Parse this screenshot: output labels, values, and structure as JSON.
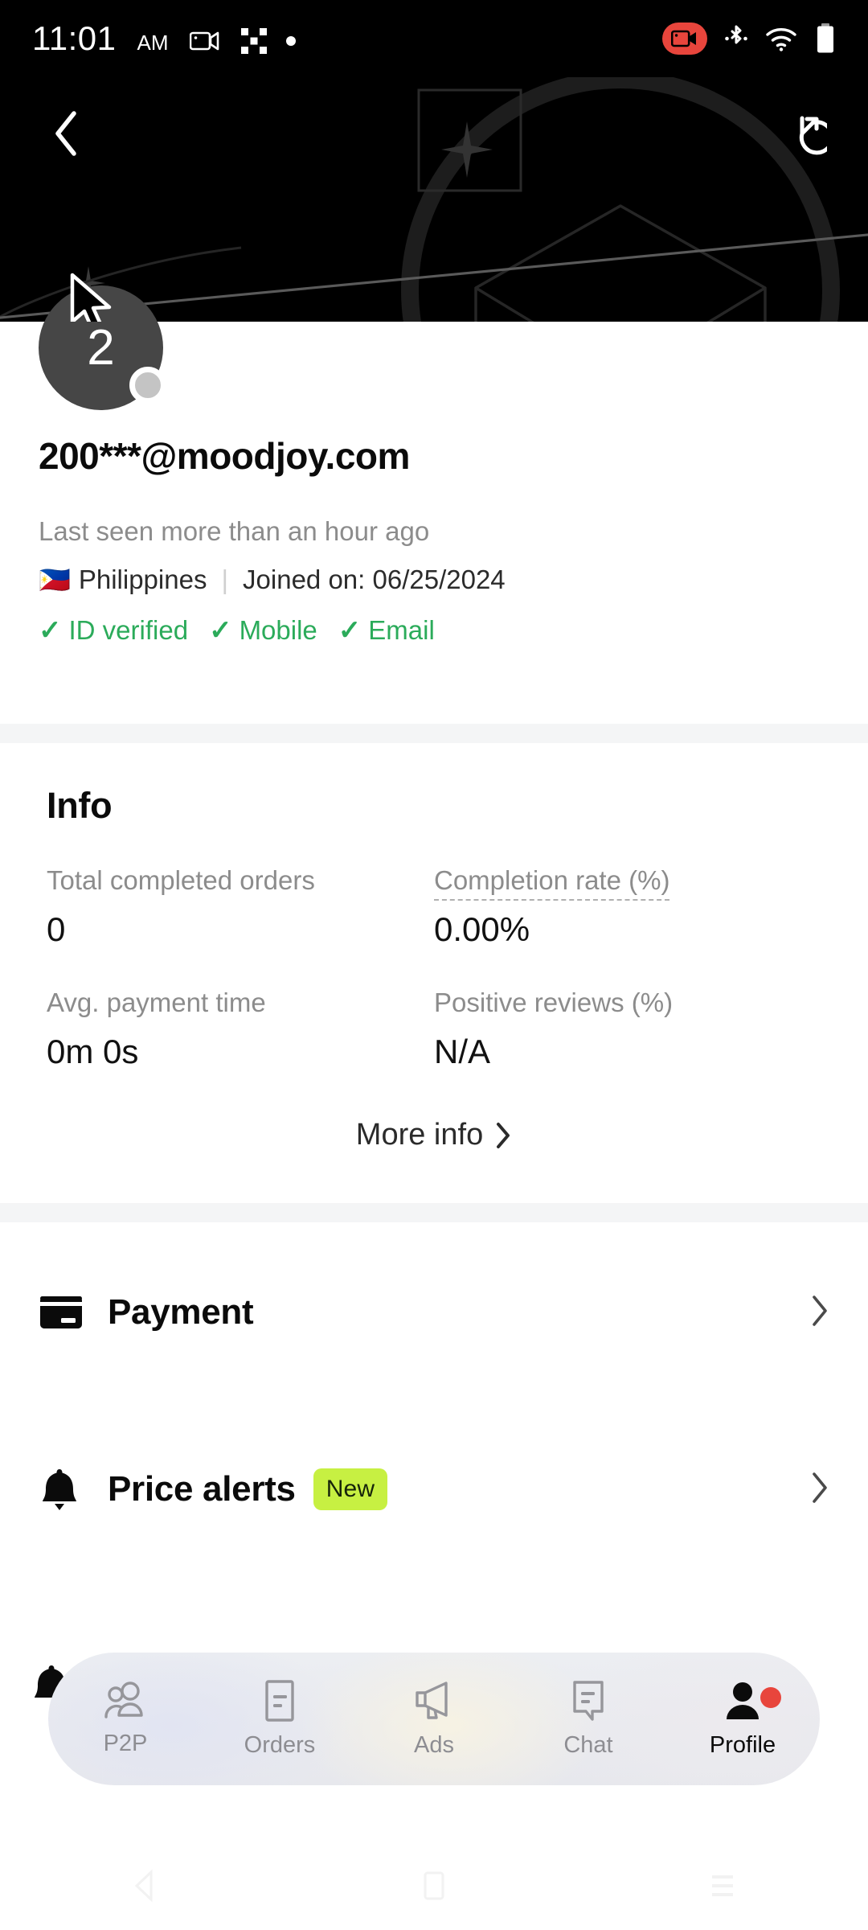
{
  "status_bar": {
    "time": "11:01",
    "ampm": "AM",
    "icons": [
      "screen-record-icon",
      "app-grid-icon",
      "dot-indicator-icon",
      "screen-record-active-icon",
      "bluetooth-icon",
      "wifi-icon",
      "battery-icon"
    ]
  },
  "header": {
    "back_label": "‹",
    "share_label": "share-refresh-icon"
  },
  "profile": {
    "avatar_initial": "2",
    "username": "200***@moodjoy.com",
    "last_seen": "Last seen more than an hour ago",
    "flag": "🇵🇭",
    "country": "Philippines",
    "separator": "|",
    "joined": "Joined on: 06/25/2024",
    "verifications": [
      {
        "check": "✓",
        "label": "ID verified"
      },
      {
        "check": "✓",
        "label": "Mobile"
      },
      {
        "check": "✓",
        "label": "Email"
      }
    ]
  },
  "info": {
    "title": "Info",
    "stats": [
      {
        "label": "Total completed orders",
        "value": "0",
        "dashed": false
      },
      {
        "label": "Completion rate (%)",
        "value": "0.00%",
        "dashed": true
      },
      {
        "label": "Avg. payment time",
        "value": "0m 0s",
        "dashed": false
      },
      {
        "label": "Positive reviews (%)",
        "value": "N/A",
        "dashed": false
      }
    ],
    "more_info": "More info",
    "more_info_chevron": "›"
  },
  "menu": [
    {
      "label": "Payment",
      "icon": "credit-card-icon",
      "badge": null,
      "chevron": "›"
    },
    {
      "label": "Price alerts",
      "icon": "bell-icon",
      "badge": "New",
      "chevron": "›"
    }
  ],
  "bottom_nav": [
    {
      "label": "P2P",
      "icon": "people-icon",
      "active": false,
      "badge": false
    },
    {
      "label": "Orders",
      "icon": "document-icon",
      "active": false,
      "badge": false
    },
    {
      "label": "Ads",
      "icon": "megaphone-icon",
      "active": false,
      "badge": false
    },
    {
      "label": "Chat",
      "icon": "chat-bubble-icon",
      "active": false,
      "badge": false
    },
    {
      "label": "Profile",
      "icon": "person-icon",
      "active": true,
      "badge": true
    }
  ],
  "colors": {
    "accent_green": "#2bab5a",
    "badge_lime": "#c7f042",
    "notification_red": "#e8453c",
    "header_black": "#000000",
    "divider_gray": "#f4f5f6"
  }
}
